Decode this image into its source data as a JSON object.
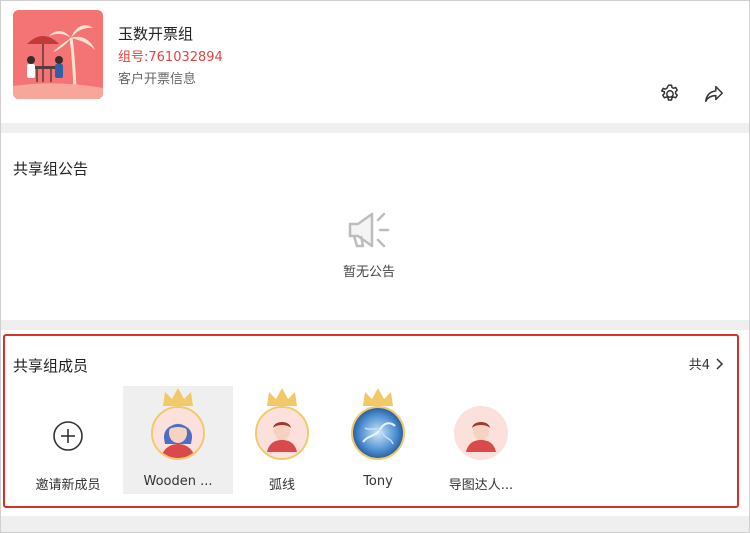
{
  "header": {
    "group_name": "玉数开票组",
    "group_id": "组号:761032894",
    "group_desc": "客户开票信息",
    "settings_icon": "gear-icon",
    "share_icon": "share-arrow-icon",
    "thumb_color": "#f47375"
  },
  "notice": {
    "title": "共享组公告",
    "empty_text": "暂无公告",
    "empty_icon": "megaphone-icon"
  },
  "members": {
    "title": "共享组成员",
    "count": "共4",
    "highlight_color": "#d9302a",
    "invite_label": "邀请新成员",
    "items": [
      {
        "label": "Wooden ...",
        "crown": true,
        "selected": true
      },
      {
        "label": "弧线",
        "crown": true,
        "selected": false
      },
      {
        "label": "Tony",
        "crown": true,
        "selected": false
      },
      {
        "label": "导图达人...",
        "crown": false,
        "selected": false
      }
    ]
  }
}
